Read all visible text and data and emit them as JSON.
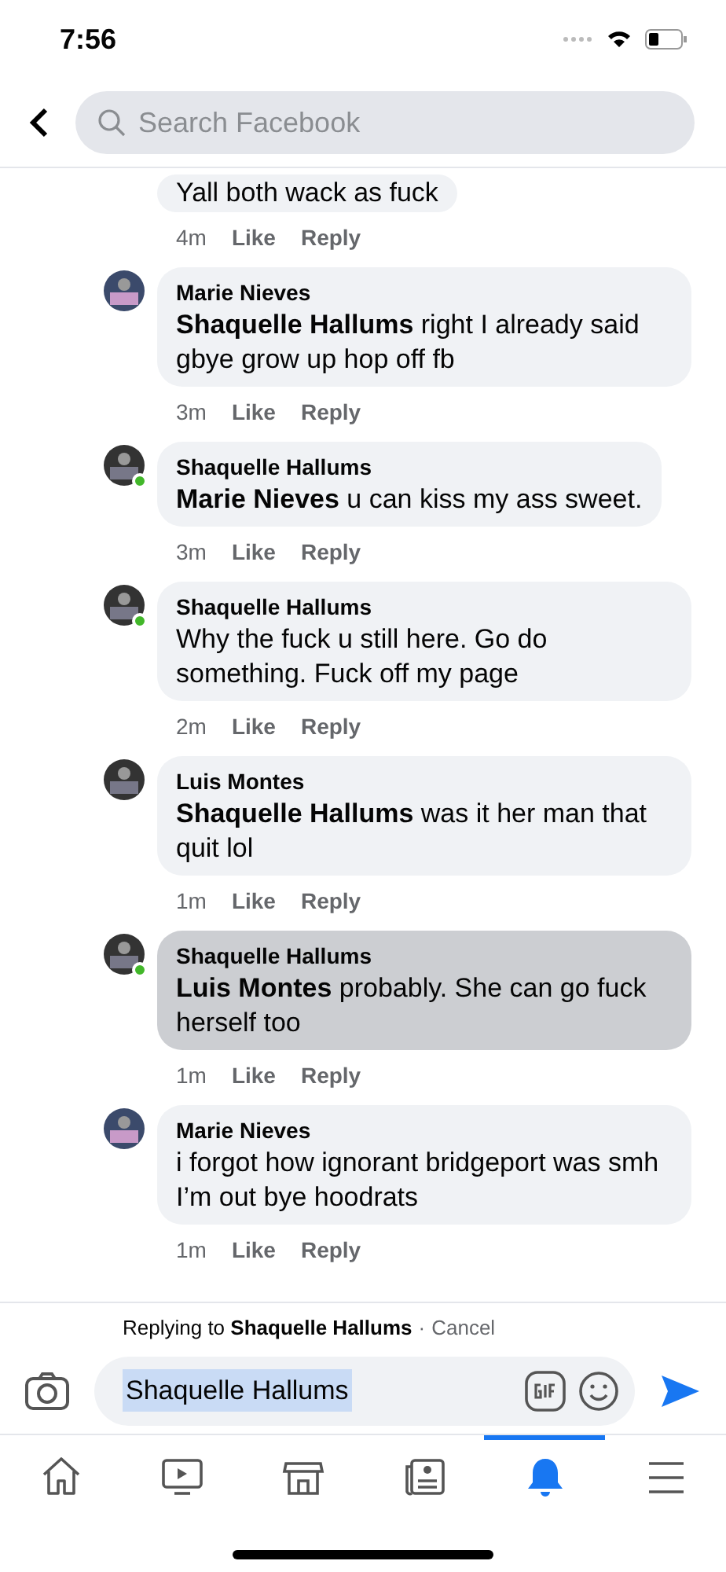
{
  "status_bar": {
    "time": "7:56"
  },
  "header": {
    "search": {
      "placeholder": "Search Facebook"
    }
  },
  "comments": [
    {
      "text": "Yall both wack as fuck",
      "time": "4m",
      "like": "Like",
      "reply": "Reply",
      "highlighted": false
    },
    {
      "author": "Marie Nieves",
      "text": "**Shaquelle Hallums** right I already said gbye grow up hop off fb",
      "time": "3m",
      "like": "Like",
      "reply": "Reply",
      "online": false,
      "highlighted": false
    },
    {
      "author": "Shaquelle Hallums",
      "text": "**Marie Nieves** u can kiss my ass sweet.",
      "time": "3m",
      "like": "Like",
      "reply": "Reply",
      "online": true,
      "highlighted": false
    },
    {
      "author": "Shaquelle Hallums",
      "text": "Why the fuck u still here. Go do something. Fuck off my page",
      "time": "2m",
      "like": "Like",
      "reply": "Reply",
      "online": true,
      "highlighted": false
    },
    {
      "author": "Luis Montes",
      "text": "**Shaquelle Hallums** was it her man that quit lol",
      "time": "1m",
      "like": "Like",
      "reply": "Reply",
      "online": false,
      "highlighted": false
    },
    {
      "author": "Shaquelle Hallums",
      "text": "**Luis Montes** probably. She can go fuck herself too",
      "time": "1m",
      "like": "Like",
      "reply": "Reply",
      "online": true,
      "highlighted": true
    },
    {
      "author": "Marie Nieves",
      "text": "i forgot how ignorant bridgeport was smh I’m out bye hoodrats",
      "time": "1m",
      "like": "Like",
      "reply": "Reply",
      "online": false,
      "highlighted": false
    }
  ],
  "composer": {
    "replying_to": "Replying to **Shaquelle Hallums**",
    "separator": "·",
    "cancel": "Cancel",
    "value": "Shaquelle Hallums",
    "value_selected": true
  },
  "tabs": [
    {
      "kind": "home",
      "selected": false
    },
    {
      "kind": "video",
      "selected": false
    },
    {
      "kind": "marketplace",
      "selected": false
    },
    {
      "kind": "news",
      "selected": false
    },
    {
      "kind": "notifications",
      "selected": true
    },
    {
      "kind": "menu",
      "selected": false
    }
  ]
}
